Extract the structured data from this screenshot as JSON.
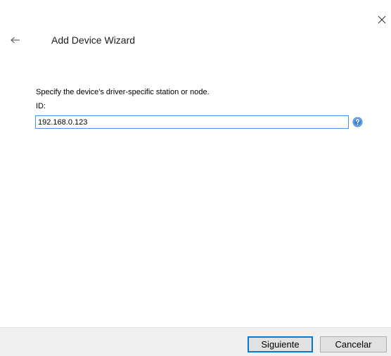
{
  "window": {
    "close_icon": "close-icon",
    "back_icon": "back-arrow-icon",
    "title": "Add Device Wizard"
  },
  "form": {
    "instruction": "Specify the device's driver-specific station or node.",
    "id_label": "ID:",
    "id_value": "192.168.0.123",
    "help_icon": "help-icon"
  },
  "footer": {
    "next_label": "Siguiente",
    "cancel_label": "Cancelar"
  },
  "colors": {
    "accent": "#0078d7",
    "input_focus_border": "#4f8ee4",
    "help_icon": "#3a7fd5",
    "footer_background": "#f0f0f0"
  }
}
